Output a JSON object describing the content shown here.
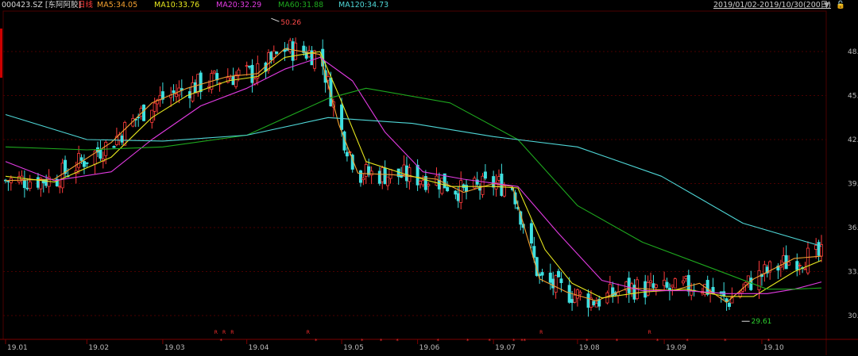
{
  "header": {
    "code_name": "000423.SZ [东阿阿胶]",
    "period": "日线",
    "ma5": "MA5:34.05",
    "ma10": "MA10:33.76",
    "ma20": "MA20:32.29",
    "ma60": "MA60:31.88",
    "ma120": "MA120:34.73",
    "range": "2019/01/02-2019/10/30(200日)"
  },
  "colors": {
    "up": "#ff3b3b",
    "down": "#3ee0e0",
    "ma5": "#f3a030",
    "ma10": "#e6e61e",
    "ma20": "#e23be2",
    "ma60": "#1ea81e",
    "ma120": "#4fd7d7",
    "grid": "#4a0000"
  },
  "chart_data": {
    "type": "candlestick",
    "title": "",
    "y_ticks": [
      "48.",
      "45.",
      "42.",
      "39.",
      "36.",
      "33.",
      "30."
    ],
    "y_range": [
      29.0,
      51.0
    ],
    "x_ticks": [
      "19.01",
      "19.02",
      "19.03",
      "19.04",
      "19.05",
      "19.06",
      "19.07",
      "19.08",
      "19.09",
      "19.10"
    ],
    "x_range": [
      "2019-01-02",
      "2019-10-30"
    ],
    "annotations": [
      {
        "text": "50.26",
        "date": "2019-04-10",
        "value": 50.26
      },
      {
        "text": "29.61",
        "date": "2019-09-30",
        "value": 29.61
      }
    ],
    "ma_series": [
      {
        "name": "MA5",
        "points": [
          [
            "2019-01-02",
            39.2
          ],
          [
            "2019-01-20",
            39.3
          ],
          [
            "2019-02-10",
            41.8
          ],
          [
            "2019-02-25",
            44.5
          ],
          [
            "2019-03-10",
            45.5
          ],
          [
            "2019-03-25",
            46.3
          ],
          [
            "2019-04-05",
            46.5
          ],
          [
            "2019-04-15",
            48.2
          ],
          [
            "2019-04-28",
            47.8
          ],
          [
            "2019-05-05",
            43.0
          ],
          [
            "2019-05-12",
            39.7
          ],
          [
            "2019-05-25",
            39.6
          ],
          [
            "2019-06-10",
            39.3
          ],
          [
            "2019-06-20",
            38.4
          ],
          [
            "2019-07-01",
            39.0
          ],
          [
            "2019-07-08",
            38.8
          ],
          [
            "2019-07-18",
            32.5
          ],
          [
            "2019-07-28",
            31.6
          ],
          [
            "2019-08-08",
            31.0
          ],
          [
            "2019-08-20",
            31.9
          ],
          [
            "2019-09-05",
            31.7
          ],
          [
            "2019-09-15",
            32.2
          ],
          [
            "2019-09-25",
            30.9
          ],
          [
            "2019-10-05",
            32.5
          ],
          [
            "2019-10-20",
            33.9
          ],
          [
            "2019-10-30",
            34.05
          ]
        ]
      },
      {
        "name": "MA10",
        "points": [
          [
            "2019-01-02",
            39.5
          ],
          [
            "2019-01-20",
            39.1
          ],
          [
            "2019-02-10",
            40.8
          ],
          [
            "2019-02-25",
            43.5
          ],
          [
            "2019-03-10",
            45.0
          ],
          [
            "2019-03-25",
            46.0
          ],
          [
            "2019-04-05",
            46.3
          ],
          [
            "2019-04-15",
            47.6
          ],
          [
            "2019-04-28",
            48.0
          ],
          [
            "2019-05-05",
            45.0
          ],
          [
            "2019-05-15",
            40.5
          ],
          [
            "2019-05-30",
            39.6
          ],
          [
            "2019-06-15",
            38.8
          ],
          [
            "2019-07-01",
            38.8
          ],
          [
            "2019-07-10",
            38.7
          ],
          [
            "2019-07-20",
            34.5
          ],
          [
            "2019-07-30",
            32.2
          ],
          [
            "2019-08-10",
            31.2
          ],
          [
            "2019-08-25",
            31.6
          ],
          [
            "2019-09-10",
            31.8
          ],
          [
            "2019-09-25",
            31.3
          ],
          [
            "2019-10-05",
            31.3
          ],
          [
            "2019-10-20",
            33.0
          ],
          [
            "2019-10-30",
            33.76
          ]
        ]
      },
      {
        "name": "MA20",
        "points": [
          [
            "2019-01-02",
            40.5
          ],
          [
            "2019-01-20",
            39.2
          ],
          [
            "2019-02-10",
            39.8
          ],
          [
            "2019-02-25",
            42.0
          ],
          [
            "2019-03-15",
            44.3
          ],
          [
            "2019-04-01",
            45.5
          ],
          [
            "2019-04-15",
            46.8
          ],
          [
            "2019-04-28",
            47.6
          ],
          [
            "2019-05-10",
            46.0
          ],
          [
            "2019-05-22",
            42.5
          ],
          [
            "2019-06-05",
            39.8
          ],
          [
            "2019-06-20",
            39.3
          ],
          [
            "2019-07-10",
            38.8
          ],
          [
            "2019-07-25",
            35.6
          ],
          [
            "2019-08-10",
            32.4
          ],
          [
            "2019-08-25",
            31.7
          ],
          [
            "2019-09-10",
            31.7
          ],
          [
            "2019-09-25",
            31.5
          ],
          [
            "2019-10-10",
            31.5
          ],
          [
            "2019-10-20",
            31.8
          ],
          [
            "2019-10-30",
            32.29
          ]
        ]
      },
      {
        "name": "MA60",
        "points": [
          [
            "2019-01-02",
            41.5
          ],
          [
            "2019-02-01",
            41.3
          ],
          [
            "2019-03-01",
            41.5
          ],
          [
            "2019-04-01",
            42.3
          ],
          [
            "2019-05-01",
            44.8
          ],
          [
            "2019-05-15",
            45.5
          ],
          [
            "2019-06-15",
            44.5
          ],
          [
            "2019-07-10",
            42.0
          ],
          [
            "2019-08-01",
            37.5
          ],
          [
            "2019-08-25",
            35.0
          ],
          [
            "2019-09-20",
            33.2
          ],
          [
            "2019-10-10",
            31.8
          ],
          [
            "2019-10-20",
            31.8
          ],
          [
            "2019-10-30",
            31.88
          ]
        ]
      },
      {
        "name": "MA120",
        "points": [
          [
            "2019-01-02",
            43.7
          ],
          [
            "2019-02-01",
            42.0
          ],
          [
            "2019-03-01",
            41.9
          ],
          [
            "2019-04-01",
            42.3
          ],
          [
            "2019-05-01",
            43.5
          ],
          [
            "2019-06-01",
            43.1
          ],
          [
            "2019-07-01",
            42.2
          ],
          [
            "2019-08-01",
            41.5
          ],
          [
            "2019-09-01",
            39.5
          ],
          [
            "2019-10-01",
            36.3
          ],
          [
            "2019-10-30",
            34.73
          ]
        ]
      }
    ]
  }
}
